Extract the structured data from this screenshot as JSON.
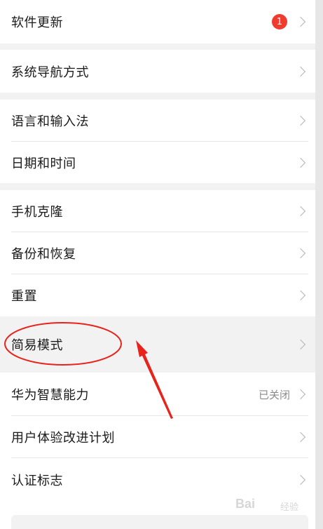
{
  "settings": {
    "items": [
      {
        "label": "软件更新",
        "badge": "1"
      },
      {
        "label": "系统导航方式"
      },
      {
        "label": "语言和输入法"
      },
      {
        "label": "日期和时间"
      },
      {
        "label": "手机克隆"
      },
      {
        "label": "备份和恢复"
      },
      {
        "label": "重置"
      },
      {
        "label": "简易模式"
      },
      {
        "label": "华为智慧能力",
        "value": "已关闭"
      },
      {
        "label": "用户体验改进计划"
      },
      {
        "label": "认证标志"
      }
    ]
  },
  "watermark": {
    "brand": "Bai",
    "suffix": "经验"
  },
  "colors": {
    "badge": "#f03b2f",
    "annotation": "#e8231b",
    "section_gap": "#f2f2f2"
  },
  "icons": {
    "chevron": "chevron-right-icon",
    "annotation_arrow": "arrow-icon",
    "annotation_circle": "ellipse-icon"
  }
}
